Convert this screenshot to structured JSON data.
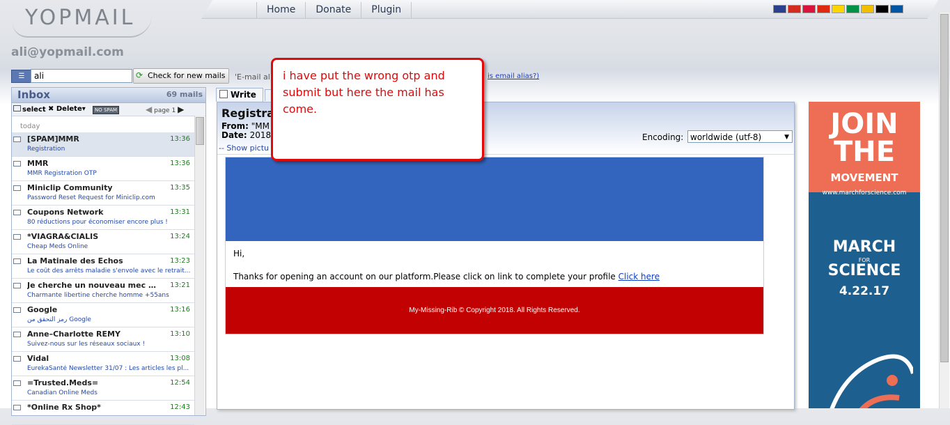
{
  "header": {
    "logo_text": "YOPMAIL",
    "nav": [
      "Home",
      "Donate",
      "Plugin"
    ],
    "flags": [
      {
        "name": "uk-flag-icon",
        "color": "#2b3f8f"
      },
      {
        "name": "russia-flag-icon",
        "color": "#d52b1e"
      },
      {
        "name": "poland-flag-icon",
        "color": "#dc143c"
      },
      {
        "name": "china-flag-icon",
        "color": "#de2910"
      },
      {
        "name": "ukraine-flag-icon",
        "color": "#ffd500"
      },
      {
        "name": "italy-flag-icon",
        "color": "#009246"
      },
      {
        "name": "spain-flag-icon",
        "color": "#f1bf00"
      },
      {
        "name": "germany-flag-icon",
        "color": "#000000"
      },
      {
        "name": "france-flag-icon",
        "color": "#0055a4"
      }
    ]
  },
  "account": "ali@yopmail.com",
  "search": {
    "value": "ali",
    "check_label": "Check for new mails",
    "alias_prefix": "'E-mail al",
    "alias_link": "is email alias?)"
  },
  "inbox": {
    "title": "Inbox",
    "count": "69 mails",
    "tools": {
      "select": "select",
      "delete": "Delete",
      "nospam": "NO SPAM",
      "page": "page 1"
    },
    "group": "today",
    "mails": [
      {
        "from": "[SPAM]MMR",
        "time": "13:36",
        "subject": "Registration",
        "selected": true
      },
      {
        "from": "MMR",
        "time": "13:36",
        "subject": "MMR Registration OTP"
      },
      {
        "from": "Miniclip Community",
        "time": "13:35",
        "subject": "Password Reset Request for Miniclip.com"
      },
      {
        "from": "Coupons Network",
        "time": "13:31",
        "subject": "80 réductions pour économiser encore plus !"
      },
      {
        "from": "*VIAGRA&CIALIS",
        "time": "13:24",
        "subject": "Cheap Meds Online"
      },
      {
        "from": "La Matinale des Echos",
        "time": "13:23",
        "subject": "Le coût des arrêts maladie s'envole avec le retrait..."
      },
      {
        "from": "Je cherche un nouveau mec tr...",
        "time": "13:21",
        "subject": "Charmante libertine cherche homme +55ans"
      },
      {
        "from": "Google",
        "time": "13:16",
        "subject": "رمز التحقق من Google"
      },
      {
        "from": "Anne–Charlotte REMY",
        "time": "13:10",
        "subject": "Suivez-nous sur les réseaux sociaux !"
      },
      {
        "from": "Vidal",
        "time": "13:08",
        "subject": "EurekaSanté Newsletter 31/07 : Les articles les pl..."
      },
      {
        "from": "=Trusted.Meds=",
        "time": "12:54",
        "subject": "Canadian Online Meds"
      },
      {
        "from": "*Online Rx Shop*",
        "time": "12:43",
        "subject": ""
      }
    ]
  },
  "message": {
    "write_tab": "Write",
    "subject": "Registra",
    "from_label": "From:",
    "from_value": "\"MM",
    "date_label": "Date:",
    "date_value": "2018",
    "show_pictures": "-- Show pictu",
    "encoding_label": "Encoding:",
    "encoding_value": "worldwide (utf-8)",
    "email": {
      "greeting": "Hi,",
      "body": "Thanks for opening an account on our platform.Please click on link to complete your profile ",
      "link": "Click here",
      "footer": "My-Missing-Rib © Copyright 2018. All Rights Reserved.",
      "banner_color": "#3465be",
      "footer_color": "#c20202"
    }
  },
  "callout": {
    "text": "i have put the wrong otp and submit but here the mail has come.",
    "color": "#e10a0a"
  },
  "ad": {
    "join": "JOIN",
    "the": "THE",
    "movement": "MOVEMENT",
    "url": "www.marchforscience.com",
    "march": "MARCH",
    "for": "FOR",
    "science": "SCIENCE",
    "date": "4.22.17"
  }
}
